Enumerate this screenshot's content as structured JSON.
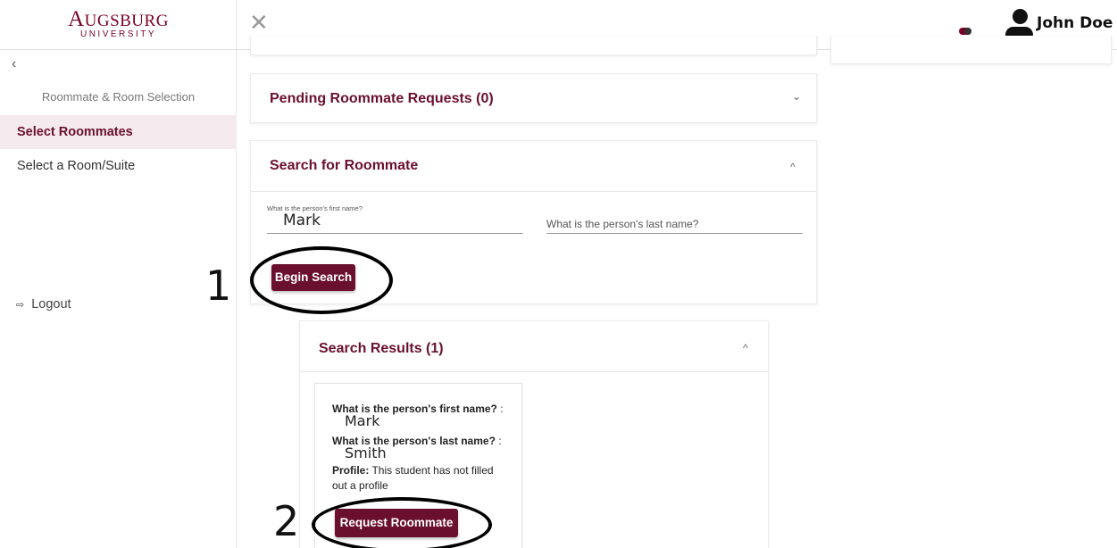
{
  "logo": {
    "name_cap": "A",
    "name_rest": "UGSBURG",
    "sub": "UNIVERSITY"
  },
  "sidebar": {
    "collapse_glyph": "‹",
    "section_title": "Roommate & Room Selection",
    "items": [
      {
        "label": "Select Roommates",
        "active": true
      },
      {
        "label": "Select a Room/Suite",
        "active": false
      }
    ],
    "logout_label": "Logout"
  },
  "header": {
    "close_glyph": "✕",
    "user_name": "John Doe",
    "accent": "#7a0026"
  },
  "pending": {
    "title": "Pending Roommate Requests (0)",
    "chevron": "⌄"
  },
  "search": {
    "title": "Search for Roommate",
    "chevron": "^",
    "first_name_label": "What is the person's first name?",
    "first_name_value": "Mark",
    "last_name_placeholder": "What is the person's last name?",
    "button_label": "Begin Search"
  },
  "results": {
    "title": "Search Results (1)",
    "chevron": "^",
    "card": {
      "q_first": "What is the person's first name?",
      "sep": " :",
      "a_first": "Mark",
      "q_last": "What is the person's last name?",
      "a_last": "Smith",
      "profile_label": "Profile:",
      "profile_text": " This student has not filled out a profile",
      "button_label": "Request Roommate"
    }
  },
  "annotations": {
    "one": "1",
    "two": "2"
  }
}
